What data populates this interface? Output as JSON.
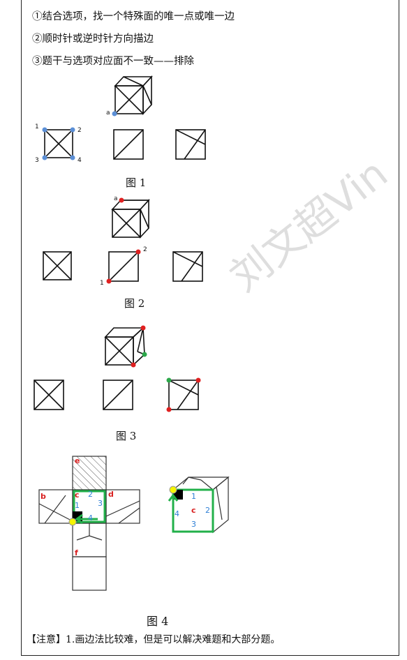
{
  "lines": [
    "①结合选项，找一个特殊面的唯一点或唯一边",
    "②顺时针或逆时针方向描边",
    "③题干与选项对应面不一致——排除"
  ],
  "captions": {
    "fig1": "图 1",
    "fig2": "图 2",
    "fig3": "图 3",
    "fig4": "图 4"
  },
  "fig1": {
    "point_a": "a",
    "corners": [
      "1",
      "2",
      "3",
      "4"
    ]
  },
  "fig2": {
    "point_a": "a",
    "p1": "1",
    "p2": "2"
  },
  "fig4": {
    "net": {
      "e": "e",
      "b": "b",
      "c": "c",
      "d": "d",
      "f": "f",
      "n1": "1",
      "n2": "2",
      "n3": "3",
      "n4": "4"
    },
    "cube": {
      "c": "c",
      "n1": "1",
      "n2": "2",
      "n3": "3",
      "n4": "4"
    }
  },
  "note": "【注意】1.画边法比较难，但是可以解决难题和大部分题。",
  "watermark": "刘文超Vin",
  "colors": {
    "blue_point": "#5b8fd6",
    "red_point": "#e02020",
    "green_point": "#2ca84a",
    "green_path": "#22b04a",
    "yellow_point": "#f5f500",
    "red_label": "#d81e1e",
    "blue_label": "#2e7fd6"
  }
}
